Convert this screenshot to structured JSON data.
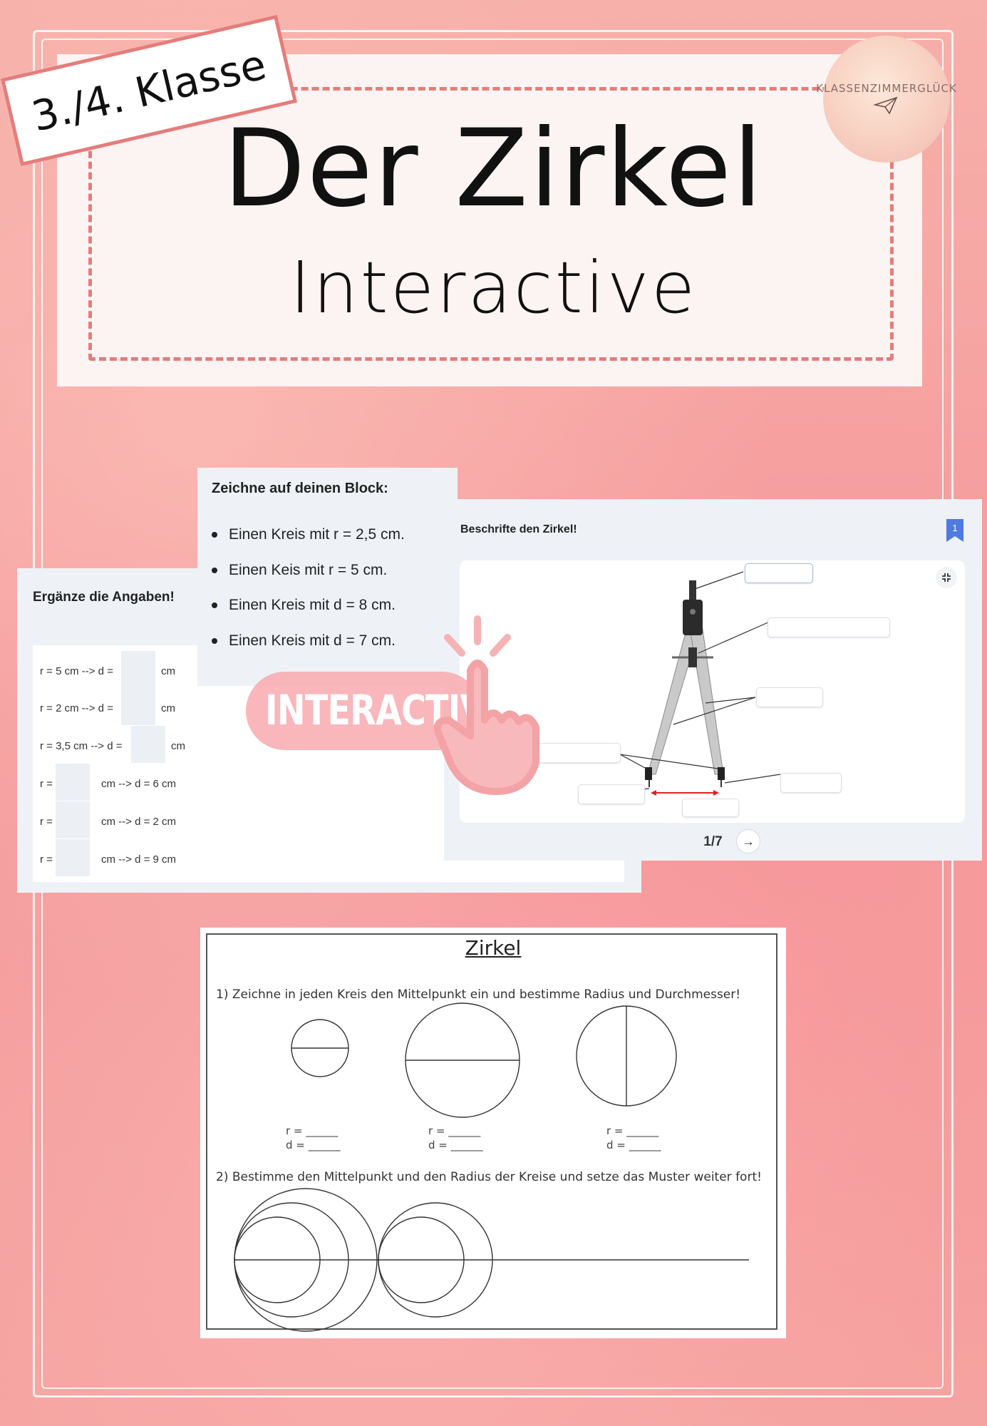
{
  "cover": {
    "grade": "3./4. Klasse",
    "title": "Der Zirkel",
    "subtitle": "Interactive",
    "logo_text": "KLASSENZIMMERGLÜCK",
    "logo_icon": "paper-plane-icon"
  },
  "slide_ergaenze": {
    "heading": "Ergänze die Angaben!",
    "rows": [
      {
        "prefix": "r = 5 cm --> d =",
        "suffix": "cm"
      },
      {
        "prefix": "r = 2 cm --> d =",
        "suffix": "cm"
      },
      {
        "prefix": "r = 3,5 cm --> d =",
        "suffix": "cm"
      },
      {
        "prefix": "r =",
        "suffix": "cm --> d = 6 cm"
      },
      {
        "prefix": "r =",
        "suffix": "cm --> d = 2 cm"
      },
      {
        "prefix": "r =",
        "suffix": "cm --> d = 9 cm"
      }
    ]
  },
  "slide_zeichne": {
    "heading": "Zeichne auf deinen Block:",
    "items": [
      "Einen Kreis mit r = 2,5 cm.",
      "Einen Keis mit r = 5 cm.",
      "Einen Kreis mit d = 8 cm.",
      "Einen Kreis mit d = 7 cm."
    ]
  },
  "slide_beschrifte": {
    "heading": "Beschrifte den Zirkel!",
    "bookmark_number": "1",
    "pager": "1/7",
    "next_symbol": "→",
    "accent_color": "#4f7ae0"
  },
  "badge": {
    "text": "INTERACTIVE",
    "icon": "pointing-hand-icon"
  },
  "worksheet": {
    "title": "Zirkel",
    "task1": "1) Zeichne in jeden Kreis den Mittelpunkt ein und bestimme Radius und Durchmesser!",
    "task2": "2) Bestimme den Mittelpunkt und den Radius der Kreise und setze das Muster weiter fort!",
    "fill_r": "r = ______",
    "fill_d": "d = ______"
  }
}
